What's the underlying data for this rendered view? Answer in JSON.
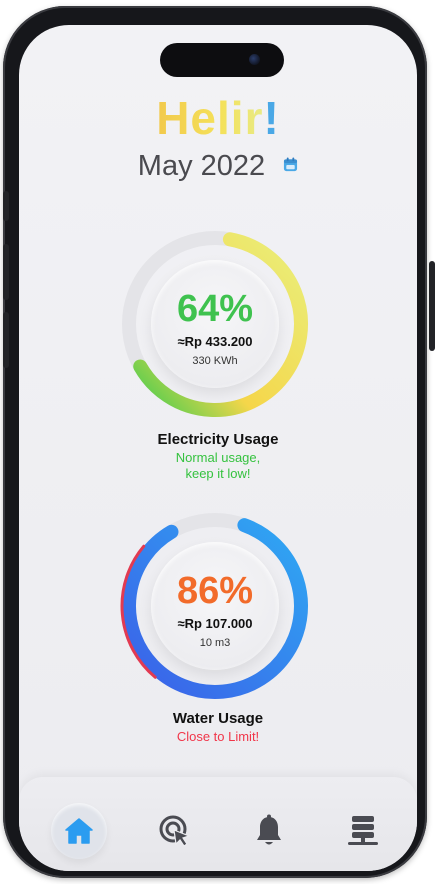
{
  "app": {
    "name": "Helir",
    "exclamation": "!"
  },
  "header": {
    "month": "May 2022",
    "calendar_icon": "calendar-icon"
  },
  "electricity": {
    "percent_label": "64%",
    "percent": 64,
    "cost": "≈Rp 433.200",
    "amount": "330 KWh",
    "title": "Electricity Usage",
    "status_line1": "Normal usage,",
    "status_line2": "keep it low!",
    "colors": {
      "start": "#3fcc4f",
      "mid": "#f5d64a",
      "end": "#e9ef7c",
      "status": "#35c23f"
    }
  },
  "water": {
    "percent_label": "86%",
    "percent": 86,
    "cost": "≈Rp 107.000",
    "amount": "10 m3",
    "title": "Water Usage",
    "status": "Close to Limit!",
    "colors": {
      "start": "#2fa9f3",
      "end": "#3b64e9",
      "alert": "#e23a52",
      "status": "#f1364a"
    }
  },
  "tabbar": {
    "items": [
      {
        "name": "home",
        "icon": "home-icon",
        "active": true
      },
      {
        "name": "tap",
        "icon": "tap-icon",
        "active": false
      },
      {
        "name": "notifications",
        "icon": "bell-icon",
        "active": false
      },
      {
        "name": "menu",
        "icon": "database-icon",
        "active": false
      }
    ],
    "active_color": "#2b9cf0",
    "inactive_color": "#4a4b52"
  }
}
